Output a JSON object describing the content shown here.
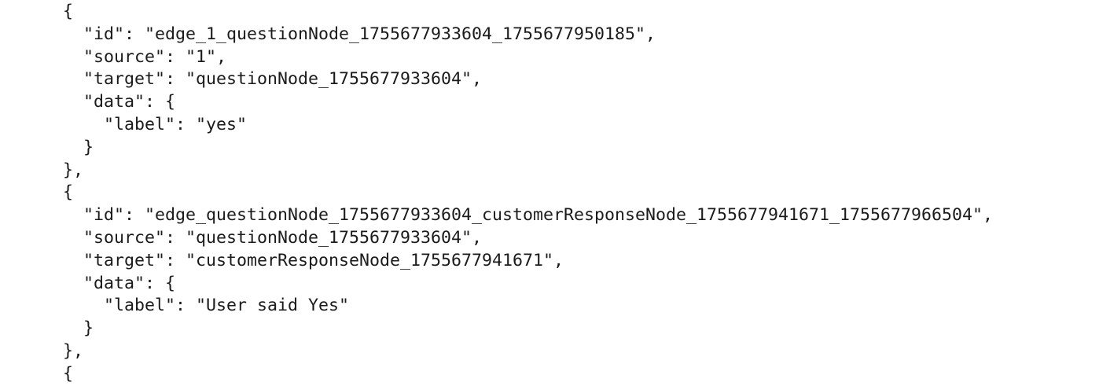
{
  "document": {
    "lines": [
      "{",
      "  \"id\": \"edge_1_questionNode_1755677933604_1755677950185\",",
      "  \"source\": \"1\",",
      "  \"target\": \"questionNode_1755677933604\",",
      "  \"data\": {",
      "    \"label\": \"yes\"",
      "  }",
      "},",
      "{",
      "  \"id\": \"edge_questionNode_1755677933604_customerResponseNode_1755677941671_1755677966504\",",
      "  \"source\": \"questionNode_1755677933604\",",
      "  \"target\": \"customerResponseNode_1755677941671\",",
      "  \"data\": {",
      "    \"label\": \"User said Yes\"",
      "  }",
      "},",
      "{"
    ]
  }
}
